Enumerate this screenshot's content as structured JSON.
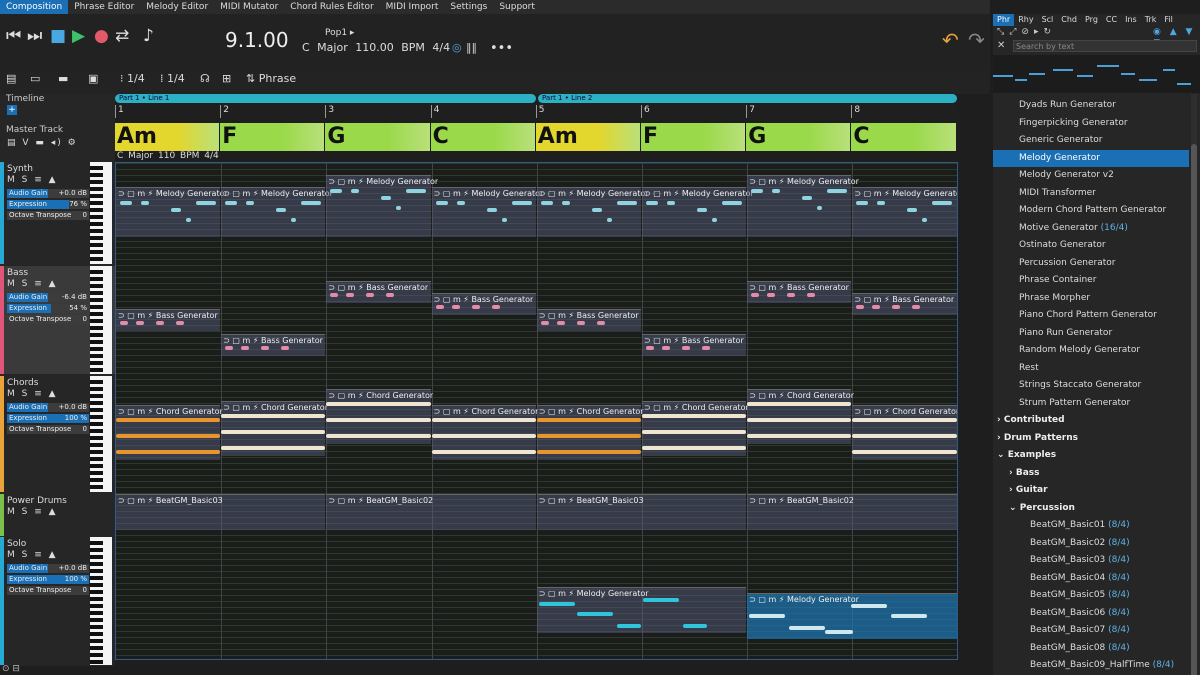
{
  "menu": [
    "Composition",
    "Phrase Editor",
    "Melody Editor",
    "MIDI Mutator",
    "Chord Rules Editor",
    "MIDI Import",
    "Settings",
    "Support"
  ],
  "transport": {
    "position": "9.1.00",
    "preset": "Pop1",
    "key": "C Major",
    "bpm": "110.00 BPM",
    "meter": "4/4"
  },
  "toolbar2": {
    "grid1": "1/4",
    "grid2": "1/4",
    "mode": "Phrase"
  },
  "labels": {
    "timeline": "Timeline",
    "master": "Master Track",
    "keyline": "C Major   110 BPM   4/4"
  },
  "parts": [
    "Part 1 • Line 1",
    "Part 1 • Line 2"
  ],
  "bars": [
    "1",
    "2",
    "3",
    "4",
    "5",
    "6",
    "7",
    "8"
  ],
  "chords": [
    "Am",
    "F",
    "G",
    "C",
    "Am",
    "F",
    "G",
    "C"
  ],
  "tracks": [
    {
      "name": "Synth",
      "gain": "+0.0 dB",
      "expression": "76 %",
      "transpose": "0",
      "color": "#27a9d6"
    },
    {
      "name": "Bass",
      "gain": "-6.4 dB",
      "expression": "54 %",
      "transpose": "0",
      "color": "#e0567a"
    },
    {
      "name": "Chords",
      "gain": "+0.0 dB",
      "expression": "100 %",
      "transpose": "0",
      "color": "#e8a33a"
    },
    {
      "name": "Power Drums",
      "gain": "",
      "expression": "",
      "transpose": "",
      "color": "#7cc04a"
    },
    {
      "name": "Solo",
      "gain": "+0.0 dB",
      "expression": "100 %",
      "transpose": "0",
      "color": "#27a9d6"
    }
  ],
  "param_names": {
    "gain": "Audio Gain",
    "expression": "Expression",
    "transpose": "Octave Transpose"
  },
  "blocks": {
    "melody": "Melody Generator",
    "bass": "Bass Generator",
    "chord": "Chord Generator",
    "drum1": "BeatGM_Basic03",
    "drum2": "BeatGM_Basic02"
  },
  "rtabs": [
    "Phr",
    "Rhy",
    "Scl",
    "Chd",
    "Prg",
    "CC",
    "Ins",
    "Trk",
    "Fil"
  ],
  "search_placeholder": "Search by text",
  "list": [
    {
      "label": "Dyads Run Generator",
      "count": ""
    },
    {
      "label": "Fingerpicking Generator",
      "count": ""
    },
    {
      "label": "Generic Generator",
      "count": ""
    },
    {
      "label": "Melody Generator",
      "count": ""
    },
    {
      "label": "Melody Generator v2",
      "count": ""
    },
    {
      "label": "MIDI Transformer",
      "count": ""
    },
    {
      "label": "Modern Chord Pattern Generator",
      "count": ""
    },
    {
      "label": "Motive Generator",
      "count": "(16/4)"
    },
    {
      "label": "Ostinato Generator",
      "count": ""
    },
    {
      "label": "Percussion Generator",
      "count": ""
    },
    {
      "label": "Phrase Container",
      "count": ""
    },
    {
      "label": "Phrase Morpher",
      "count": ""
    },
    {
      "label": "Piano Chord Pattern Generator",
      "count": ""
    },
    {
      "label": "Piano Run Generator",
      "count": ""
    },
    {
      "label": "Random Melody Generator",
      "count": ""
    },
    {
      "label": "Rest",
      "count": ""
    },
    {
      "label": "Strings Staccato Generator",
      "count": ""
    },
    {
      "label": "Strum Pattern Generator",
      "count": ""
    }
  ],
  "categories": [
    "Contributed",
    "Drum Patterns",
    "Examples"
  ],
  "subcats": [
    "Bass",
    "Guitar",
    "Percussion"
  ],
  "beats": [
    {
      "label": "BeatGM_Basic01",
      "count": "(8/4)"
    },
    {
      "label": "BeatGM_Basic02",
      "count": "(8/4)"
    },
    {
      "label": "BeatGM_Basic03",
      "count": "(8/4)"
    },
    {
      "label": "BeatGM_Basic04",
      "count": "(8/4)"
    },
    {
      "label": "BeatGM_Basic05",
      "count": "(8/4)"
    },
    {
      "label": "BeatGM_Basic06",
      "count": "(8/4)"
    },
    {
      "label": "BeatGM_Basic07",
      "count": "(8/4)"
    },
    {
      "label": "BeatGM_Basic08",
      "count": "(8/4)"
    },
    {
      "label": "BeatGM_Basic09_HalfTime",
      "count": "(8/4)"
    }
  ]
}
